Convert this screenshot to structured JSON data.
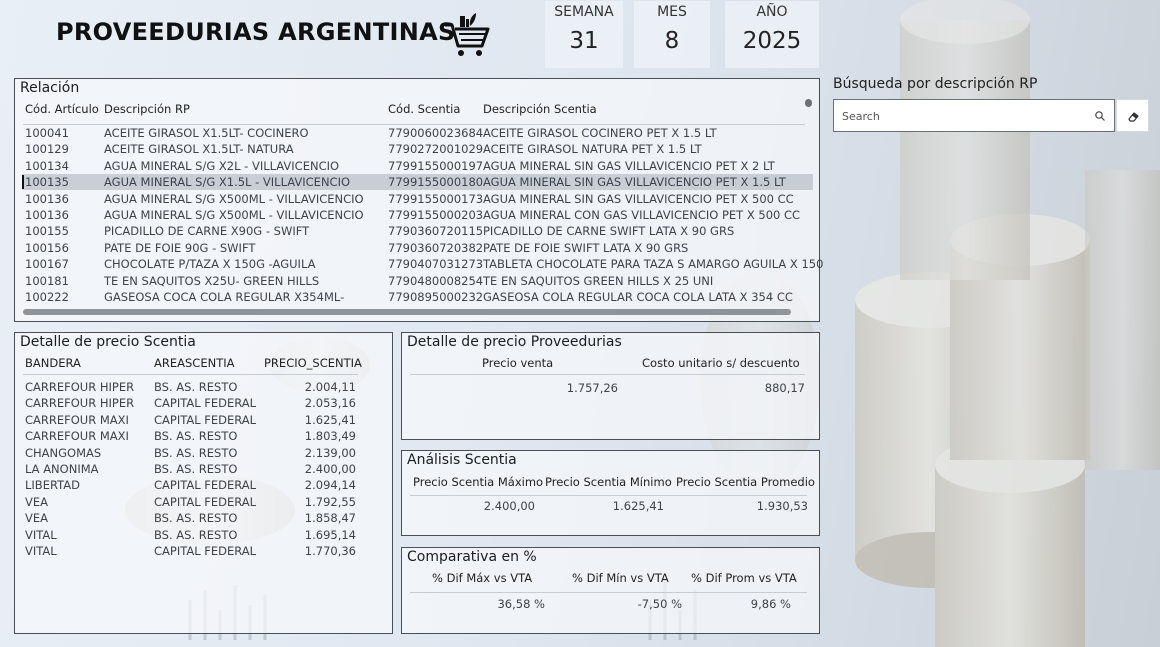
{
  "header": {
    "title": "PROVEEDURIAS ARGENTINAS",
    "kpis": [
      {
        "label": "SEMANA",
        "value": "31"
      },
      {
        "label": "MES",
        "value": "8"
      },
      {
        "label": "AÑO",
        "value": "2025"
      }
    ]
  },
  "relacion": {
    "title": "Relación",
    "columns": [
      "Cód. Artículo",
      "Descripción RP",
      "Cód. Scentia",
      "Descripción Scentia"
    ],
    "rows": [
      [
        "100041",
        "ACEITE GIRASOL X1.5LT- COCINERO",
        "7790060023684",
        "ACEITE GIRASOL COCINERO PET X 1.5 LT"
      ],
      [
        "100129",
        "ACEITE GIRASOL X1.5LT- NATURA",
        "7790272001029",
        "ACEITE GIRASOL NATURA PET X 1.5 LT"
      ],
      [
        "100134",
        "AGUA MINERAL S/G X2L - VILLAVICENCIO",
        "7799155000197",
        "AGUA MINERAL SIN GAS VILLAVICENCIO PET X 2 LT"
      ],
      [
        "100135",
        "AGUA MINERAL S/G X1.5L - VILLAVICENCIO",
        "7799155000180",
        "AGUA MINERAL SIN GAS VILLAVICENCIO PET X 1.5 LT"
      ],
      [
        "100136",
        "AGUA MINERAL S/G X500ML - VILLAVICENCIO",
        "7799155000173",
        "AGUA MINERAL SIN GAS VILLAVICENCIO PET X 500 CC"
      ],
      [
        "100136",
        "AGUA MINERAL S/G X500ML - VILLAVICENCIO",
        "7799155000203",
        "AGUA MINERAL CON GAS VILLAVICENCIO PET X 500 CC"
      ],
      [
        "100155",
        "PICADILLO DE CARNE X90G - SWIFT",
        "7790360720115",
        "PICADILLO DE CARNE SWIFT LATA X 90 GRS"
      ],
      [
        "100156",
        "PATE DE FOIE 90G - SWIFT",
        "7790360720382",
        "PATE DE FOIE SWIFT LATA X 90 GRS"
      ],
      [
        "100167",
        "CHOCOLATE P/TAZA X 150G -AGUILA",
        "7790407031273",
        "TABLETA CHOCOLATE PARA TAZA S AMARGO AGUILA X 150"
      ],
      [
        "100181",
        "TE EN SAQUITOS X25U-  GREEN HILLS",
        "7790480008254",
        "TE EN SAQUITOS GREEN HILLS X 25 UNI"
      ],
      [
        "100222",
        "GASEOSA COCA COLA REGULAR X354ML-",
        "7790895000232",
        "GASEOSA COLA REGULAR COCA COLA LATA X 354 CC"
      ]
    ],
    "selected_code": "7799155000180"
  },
  "search": {
    "label": "Búsqueda por descripción RP",
    "placeholder": "Search"
  },
  "detalle_scentia": {
    "title": "Detalle de precio Scentia",
    "columns": [
      "BANDERA",
      "AREASCENTIA",
      "PRECIO_SCENTIA"
    ],
    "rows": [
      [
        "CARREFOUR HIPER",
        "BS. AS. RESTO",
        "2.004,11"
      ],
      [
        "CARREFOUR HIPER",
        "CAPITAL FEDERAL",
        "2.053,16"
      ],
      [
        "CARREFOUR MAXI",
        "CAPITAL FEDERAL",
        "1.625,41"
      ],
      [
        "CARREFOUR MAXI",
        "BS. AS. RESTO",
        "1.803,49"
      ],
      [
        "CHANGOMAS",
        "BS. AS. RESTO",
        "2.139,00"
      ],
      [
        "LA ANONIMA",
        "BS. AS. RESTO",
        "2.400,00"
      ],
      [
        "LIBERTAD",
        "CAPITAL FEDERAL",
        "2.094,14"
      ],
      [
        "VEA",
        "CAPITAL FEDERAL",
        "1.792,55"
      ],
      [
        "VEA",
        "BS. AS. RESTO",
        "1.858,47"
      ],
      [
        "VITAL",
        "BS. AS. RESTO",
        "1.695,14"
      ],
      [
        "VITAL",
        "CAPITAL FEDERAL",
        "1.770,36"
      ]
    ]
  },
  "detalle_proveedurias": {
    "title": "Detalle de precio Proveedurias",
    "columns": [
      "Precio venta",
      "Costo unitario s/ descuento"
    ],
    "values": [
      "1.757,26",
      "880,17"
    ]
  },
  "analisis": {
    "title": "Análisis Scentia",
    "columns": [
      "Precio Scentia Máximo",
      "Precio Scentia Mínimo",
      "Precio Scentia Promedio"
    ],
    "values": [
      "2.400,00",
      "1.625,41",
      "1.930,53"
    ]
  },
  "comparativa": {
    "title": "Comparativa en %",
    "columns": [
      "% Dif Máx vs VTA",
      "% Dif Mín vs VTA",
      "% Dif Prom vs VTA"
    ],
    "values": [
      "36,58 %",
      "-7,50 %",
      "9,86 %"
    ]
  },
  "icons": {
    "cart": "shopping-cart-icon",
    "search": "search-icon",
    "erase": "eraser-icon"
  }
}
